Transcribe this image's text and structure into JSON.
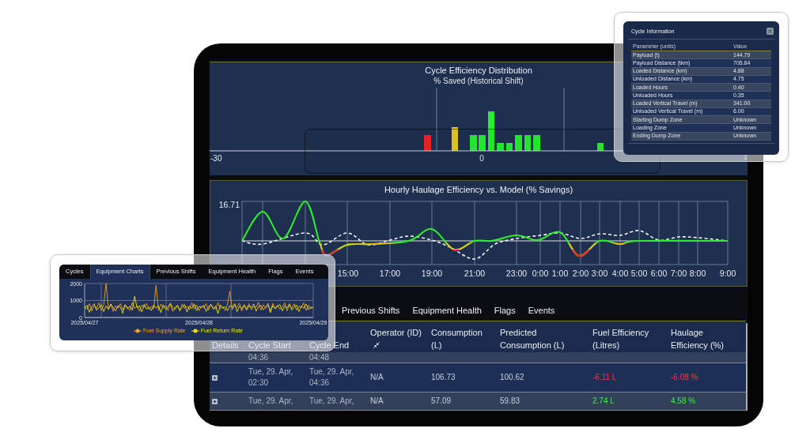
{
  "cycle_information_popup": {
    "title": "Cycle Information",
    "columns": [
      "Parameter (units)",
      "Value"
    ],
    "rows": [
      {
        "parameter": "Payload (t)",
        "value": "144.79"
      },
      {
        "parameter": "Payload Distance (tkm)",
        "value": "705.84"
      },
      {
        "parameter": "Loaded Distance (km)",
        "value": "4.88"
      },
      {
        "parameter": "Unloaded Distance (km)",
        "value": "4.75"
      },
      {
        "parameter": "Loaded Hours",
        "value": "0.40"
      },
      {
        "parameter": "Unloaded Hours",
        "value": "0.35"
      },
      {
        "parameter": "Loaded Vertical Travel (m)",
        "value": "341.00"
      },
      {
        "parameter": "Unloaded Vertical Travel (m)",
        "value": "6.00"
      },
      {
        "parameter": "Starting Dump Zone",
        "value": "Unknown"
      },
      {
        "parameter": "Loading Zone",
        "value": "Unknown"
      },
      {
        "parameter": "Ending Dump Zone",
        "value": "Unknown"
      }
    ]
  },
  "distribution_chart": {
    "title": "Cycle Efficiency Distribution",
    "subtitle": "% Saved (Historical Shift)",
    "axis_labels": [
      "-30",
      "0"
    ]
  },
  "hourly_chart": {
    "title": "Hourly Haulage Efficiency vs. Model (% Savings)",
    "y_label": "16.71",
    "x_labels": [
      "15:00",
      "17:00",
      "19:00",
      "21:00",
      "23:00",
      "0:00",
      "1:00",
      "2:00",
      "3:00",
      "4:00",
      "5:00",
      "6:00",
      "7:00",
      "8:00",
      "9:00"
    ]
  },
  "equipment_charts_popup": {
    "tabs": [
      {
        "label": "Cycles",
        "selected": false
      },
      {
        "label": "Equipment Charts",
        "selected": true
      },
      {
        "label": "Previous Shifts",
        "selected": false
      },
      {
        "label": "Equipment Health",
        "selected": false
      },
      {
        "label": "Flags",
        "selected": false
      },
      {
        "label": "Events",
        "selected": false
      }
    ],
    "chart_data": {
      "type": "line",
      "categories": [
        "2025/04/27",
        null,
        null,
        null,
        null,
        null,
        null,
        null,
        null,
        null,
        null,
        null,
        null,
        null,
        null,
        null,
        null,
        null,
        null,
        null,
        null,
        null,
        null,
        null,
        null,
        null,
        null,
        null,
        null,
        null,
        null,
        null,
        null,
        null,
        null,
        null,
        null,
        null,
        null,
        null,
        null,
        null,
        null,
        null,
        null,
        null,
        null,
        null,
        "2025/04/28",
        null,
        null,
        null,
        null,
        null,
        null,
        null,
        null,
        null,
        null,
        null,
        null,
        null,
        null,
        null,
        null,
        null,
        null,
        null,
        null,
        null,
        null,
        null,
        null,
        null,
        null,
        null,
        null,
        null,
        null,
        null,
        null,
        null,
        null,
        null,
        null,
        null,
        null,
        null,
        null,
        null,
        null,
        null,
        null,
        null,
        null,
        null,
        "2025/04/29"
      ],
      "ylim": [
        0,
        2000
      ],
      "yticks": [
        2000,
        1000,
        0
      ],
      "series": [
        {
          "name": "Fuel Supply Rate",
          "color": "#f5a21b",
          "values": [
            620,
            480,
            810,
            390,
            700,
            550,
            860,
            420,
            730,
            2000,
            510,
            780,
            360,
            690,
            540,
            820,
            450,
            760,
            600,
            410,
            870,
            530,
            680,
            380,
            740,
            590,
            830,
            470,
            650,
            520,
            1900,
            430,
            790,
            560,
            700,
            400,
            850,
            610,
            480,
            720,
            370,
            800,
            540,
            660,
            450,
            880,
            500,
            740,
            390,
            690,
            570,
            820,
            430,
            760,
            610,
            480,
            870,
            520,
            650,
            410,
            780,
            1550,
            460,
            720,
            590,
            840,
            380,
            700,
            530,
            810,
            450,
            660,
            600,
            900,
            420,
            750,
            560,
            690,
            380,
            830,
            510,
            740,
            470,
            620,
            860,
            400,
            710,
            560,
            800,
            440,
            680,
            590,
            850,
            410,
            730,
            520,
            600
          ]
        },
        {
          "name": "Fuel Return Rate",
          "color": "#f2e30a",
          "values": [
            540,
            720,
            300,
            650,
            810,
            420,
            590,
            760,
            350,
            680,
            470,
            800,
            560,
            380,
            700,
            610,
            250,
            740,
            520,
            660,
            430,
            1250,
            580,
            690,
            330,
            770,
            500,
            620,
            410,
            730,
            560,
            680,
            290,
            750,
            480,
            640,
            820,
            370,
            600,
            710,
            450,
            580,
            760,
            320,
            690,
            530,
            800,
            410,
            650,
            570,
            720,
            360,
            610,
            780,
            490,
            670,
            230,
            740,
            550,
            630,
            400,
            700,
            590,
            810,
            340,
            660,
            520,
            750,
            430,
            690,
            580,
            800,
            370,
            640,
            720,
            460,
            590,
            830,
            280,
            700,
            510,
            650,
            760,
            390,
            680,
            560,
            810,
            440,
            600,
            730,
            350,
            670,
            540,
            790,
            460,
            620,
            580
          ]
        }
      ]
    }
  },
  "tabs": [
    {
      "label": "Previous Shifts",
      "selected": false
    },
    {
      "label": "Equipment Health",
      "selected": false
    },
    {
      "label": "Flags",
      "selected": false
    },
    {
      "label": "Events",
      "selected": false
    }
  ],
  "table": {
    "columns": [
      {
        "label": "Details",
        "kind": "plain"
      },
      {
        "label": "Cycle Start",
        "kind": "plain"
      },
      {
        "label": "Cycle End",
        "kind": "plain"
      },
      {
        "label": "Operator (ID)",
        "kind": "collapsible"
      },
      {
        "label": "Consumption (L)",
        "kind": "plain"
      },
      {
        "label": "Predicted Consumption (L)",
        "kind": "plain"
      },
      {
        "label": "Fuel Efficiency (Litres)",
        "kind": "plain"
      },
      {
        "label": "Haulage Efficiency (%)",
        "kind": "plain"
      }
    ],
    "rows": [
      {
        "kind": "partial",
        "cycle_start": "04:36",
        "cycle_end": "04:48"
      },
      {
        "kind": "full",
        "expanded": false,
        "cycle_start": "Tue, 29. Apr, 02:30",
        "cycle_end": "Tue, 29. Apr, 04:36",
        "operator": "N/A",
        "consumption": "106.73",
        "predicted_consumption": "100.62",
        "fuel_efficiency": "-6.11 L",
        "haulage_efficiency": "-6.08 %",
        "saving": false
      },
      {
        "kind": "full",
        "expanded": false,
        "cycle_start": "Tue, 29. Apr,",
        "cycle_end": "Tue, 29. Apr,",
        "operator": "N/A",
        "consumption": "57.09",
        "predicted_consumption": "59.83",
        "fuel_efficiency": "2.74 L",
        "haulage_efficiency": "4.58 %",
        "saving": true
      }
    ]
  }
}
